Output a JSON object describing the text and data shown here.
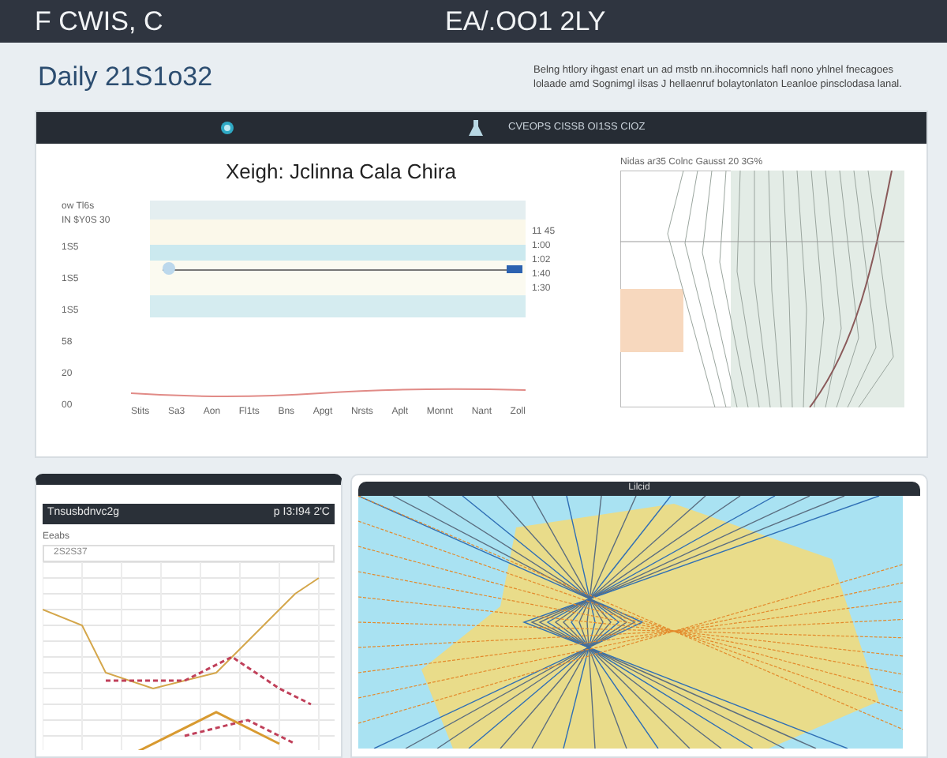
{
  "top_bar": {
    "title": "F CWIS, C",
    "center_text": "EA/.OO1 2LY"
  },
  "header": {
    "title": "Daily 21S1o32",
    "description": "Belng htlory ihgast enart un ad mstb nn.ihocomnicls hafl nono yhlnel fnecagoes lolaade amd Sognimgl ilsas J hellaenruf bolaytonlaton Leanloe pinsclodasa lanal."
  },
  "overview_card": {
    "toolbar_text": "CVEOPS CISSB OI1SS CIOZ",
    "chart": {
      "title": "Xeigh: Jclinna Cala Chira",
      "legend": [
        "ow Tl6s",
        "IN $Y0S 30"
      ],
      "y_labels": [
        "1S5",
        "1S5",
        "1S5",
        "58",
        "20",
        "00"
      ],
      "right_labels": [
        "11 45",
        "1:00",
        "1:02",
        "1:40",
        "1:30"
      ],
      "x_labels": [
        "Stits",
        "Sa3",
        "Aon",
        "Fl1ts",
        "Bns",
        "Apgt",
        "Nrsts",
        "Aplt",
        "Monnt",
        "Nant",
        "Zoll"
      ]
    },
    "map": {
      "title": "Nidas ar35 Colnc Gausst 20 3G%"
    }
  },
  "route_card": {
    "bar_left": "Tnsusbdnvc2g",
    "bar_right": "p I3:I94 2'C",
    "label": "Eeabs",
    "field_value": "2S2S37"
  },
  "map_card": {
    "title": "Lilcid"
  }
}
